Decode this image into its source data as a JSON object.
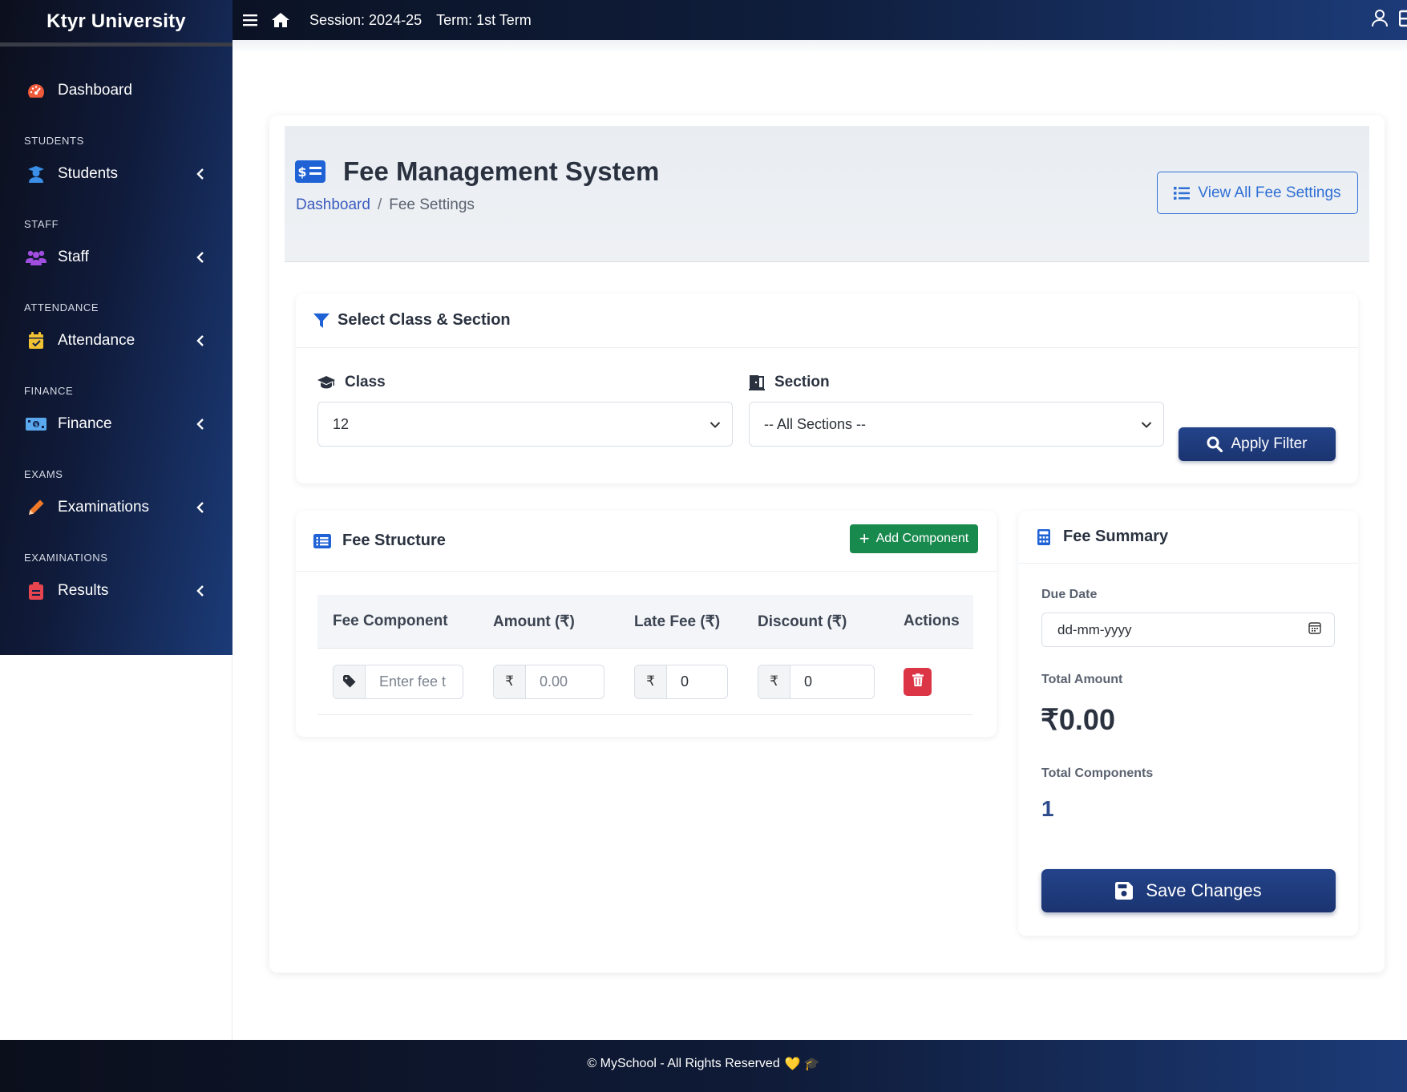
{
  "brand": {
    "name": "Ktyr University"
  },
  "sidebar": {
    "dashboard": {
      "label": "Dashboard",
      "icon": "gauge-icon",
      "icon_color": "#ef5a3a"
    },
    "sections": [
      {
        "heading": "STUDENTS",
        "label": "Students",
        "icon": "graduate-icon",
        "icon_color": "#3b8fe8"
      },
      {
        "heading": "STAFF",
        "label": "Staff",
        "icon": "users-icon",
        "icon_color": "#a14ee0"
      },
      {
        "heading": "ATTENDANCE",
        "label": "Attendance",
        "icon": "calendar-check-icon",
        "icon_color": "#f1c232"
      },
      {
        "heading": "FINANCE",
        "label": "Finance",
        "icon": "money-bill-icon",
        "icon_color": "#5aa9ee"
      },
      {
        "heading": "EXAMS",
        "label": "Examinations",
        "icon": "pencil-icon",
        "icon_color": "#f07a2a"
      },
      {
        "heading": "EXAMINATIONS",
        "label": "Results",
        "icon": "clipboard-icon",
        "icon_color": "#e6454f"
      }
    ]
  },
  "topbar": {
    "session": "Session: 2024-25",
    "term": "Term: 1st Term"
  },
  "page": {
    "title": "Fee Management System",
    "breadcrumb": {
      "home": "Dashboard",
      "current": "Fee Settings"
    },
    "view_all_label": "View All Fee Settings"
  },
  "filter": {
    "title": "Select Class & Section",
    "class_label": "Class",
    "class_value": "12",
    "section_label": "Section",
    "section_value": "-- All Sections --",
    "apply_label": "Apply Filter"
  },
  "fee_structure": {
    "title": "Fee Structure",
    "add_label": "Add Component",
    "columns": [
      "Fee Component",
      "Amount (₹)",
      "Late Fee (₹)",
      "Discount (₹)",
      "Actions"
    ],
    "row": {
      "component_placeholder": "Enter fee t",
      "currency": "₹",
      "amount_placeholder": "0.00",
      "late_fee": "0",
      "discount": "0"
    }
  },
  "summary": {
    "title": "Fee Summary",
    "due_date_label": "Due Date",
    "due_date_placeholder": "dd-mm-yyyy",
    "total_amount_label": "Total Amount",
    "total_amount": "₹0.00",
    "total_components_label": "Total Components",
    "total_components": "1",
    "save_label": "Save Changes"
  },
  "footer": {
    "text": "© MySchool - All Rights Reserved",
    "heart": "💛",
    "cap": "🎓"
  },
  "colors": {
    "primary": "#1b3470",
    "accent_blue": "#2f6fd6",
    "success": "#198a4e",
    "danger": "#dc3545"
  }
}
